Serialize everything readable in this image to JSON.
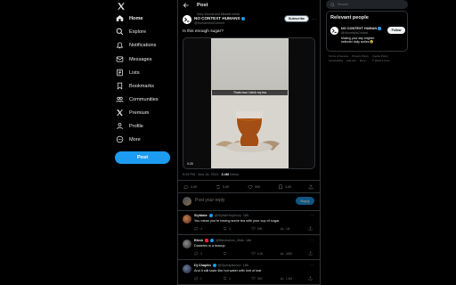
{
  "nav": {
    "items": [
      {
        "label": "Home",
        "icon": "home-icon"
      },
      {
        "label": "Explore",
        "icon": "search-icon"
      },
      {
        "label": "Notifications",
        "icon": "bell-icon"
      },
      {
        "label": "Messages",
        "icon": "envelope-icon"
      },
      {
        "label": "Lists",
        "icon": "list-icon"
      },
      {
        "label": "Bookmarks",
        "icon": "bookmark-icon"
      },
      {
        "label": "Communities",
        "icon": "people-icon"
      },
      {
        "label": "Premium",
        "icon": "x-logo-icon"
      },
      {
        "label": "Profile",
        "icon": "person-icon"
      },
      {
        "label": "More",
        "icon": "more-circle-icon"
      }
    ],
    "post_button": "Post"
  },
  "header": {
    "title": "Post"
  },
  "tweet": {
    "social_context": "Sany Woods and Mikaele follow",
    "author_name": "NO CONTEXT HUMANS",
    "author_handle": "@HumansNoContext",
    "subscribe_label": "Subscribe",
    "text": "Is this enough sugar?",
    "video_caption": "Thats how I drink my tea",
    "video_time": "0:20",
    "time": "9:49 PM",
    "date": "Nov 24, 2023",
    "views": "3.4M",
    "views_label": "Views",
    "stats": {
      "replies": "3.5K",
      "reposts": "5.8K",
      "likes": "59K",
      "bookmarks": "3.6K"
    }
  },
  "composer": {
    "placeholder": "Post your reply",
    "button": "Reply"
  },
  "replies": [
    {
      "name": "Siyfdate",
      "handle": "@SiyfahHolyHory",
      "age": "18h",
      "text": "You mean you're having some tea with your cup of sugar.",
      "replies": "4",
      "reposts": "3",
      "likes": "53K",
      "views": "1M"
    },
    {
      "name": "Bleck",
      "handle": "@Bleckshulu_Bids",
      "age": "18h",
      "text": "Diabetes in a teacup",
      "replies": "3",
      "reposts": "",
      "likes": "6.2K",
      "views": "420K"
    },
    {
      "name": "Dj Chaplin",
      "handle": "@Djchaplinnnn",
      "age": "18h",
      "text": "And it still taste like hot water with hint of leaf",
      "replies": "1",
      "reposts": "1",
      "likes": "31K",
      "views": "1.4M"
    }
  ],
  "right": {
    "search_placeholder": "Search",
    "panel_title": "Relevant people",
    "person_name": "NO CONTEXT HUMAN",
    "person_handle": "@HumansNoContext",
    "person_bio": "Making your day brighter. #ellenter daily smiles 😂",
    "follow_label": "Follow",
    "footer": [
      "Terms of Service",
      "Privacy Policy",
      "Cookie Policy",
      "Accessibility",
      "Ads info",
      "More ...",
      "© 2023 X Corp."
    ]
  }
}
